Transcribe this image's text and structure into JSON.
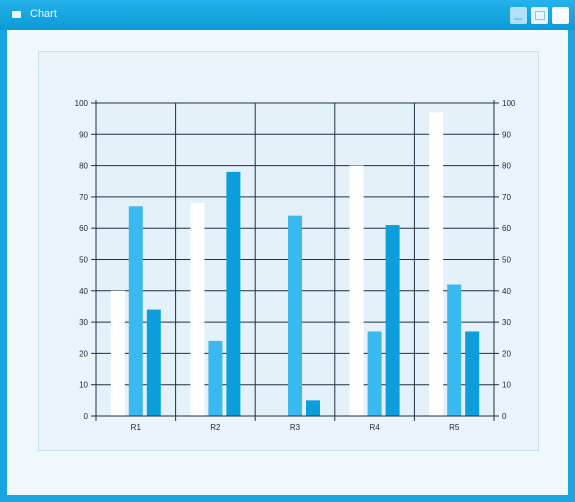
{
  "window": {
    "title": "Chart",
    "colors": {
      "frame": "#1aa3dc",
      "client": "#f1f8fc",
      "panel": "#e9f3f9"
    }
  },
  "chart_data": {
    "type": "bar",
    "categories": [
      "R1",
      "R2",
      "R3",
      "R4",
      "R5"
    ],
    "series": [
      {
        "color": "#ffffff",
        "values": [
          40,
          68,
          0,
          80,
          97
        ]
      },
      {
        "color": "#3bb8ee",
        "values": [
          67,
          24,
          64,
          27,
          42
        ]
      },
      {
        "color": "#0a9fdb",
        "values": [
          34,
          78,
          5,
          61,
          27
        ]
      }
    ],
    "yticks": [
      0,
      10,
      20,
      30,
      40,
      50,
      60,
      70,
      80,
      90,
      100
    ],
    "ylim": [
      0,
      100
    ],
    "grid": true,
    "title": "",
    "xlabel": "",
    "ylabel": ""
  }
}
